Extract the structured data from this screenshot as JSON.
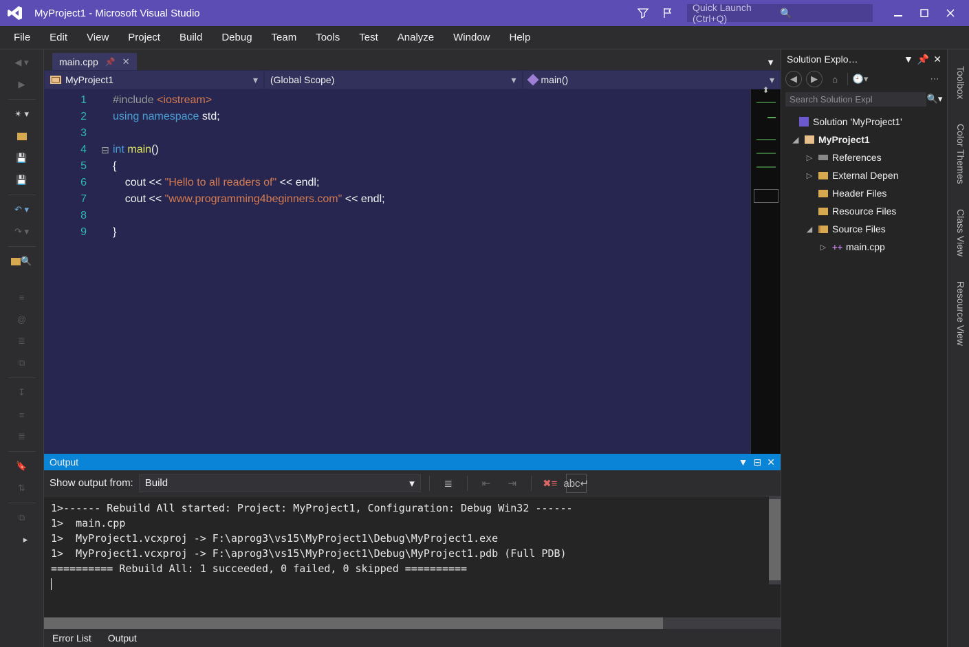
{
  "title": "MyProject1 - Microsoft Visual Studio",
  "quick_launch_placeholder": "Quick Launch (Ctrl+Q)",
  "menu": [
    "File",
    "Edit",
    "View",
    "Project",
    "Build",
    "Debug",
    "Team",
    "Tools",
    "Test",
    "Analyze",
    "Window",
    "Help"
  ],
  "tab": {
    "name": "main.cpp"
  },
  "nav": {
    "project": "MyProject1",
    "scope": "(Global Scope)",
    "member": "main()"
  },
  "code": {
    "lines": [
      {
        "n": "1",
        "html": "<span class='k-prep'>#include</span> <span class='k-include'>&lt;iostream&gt;</span>"
      },
      {
        "n": "2",
        "html": "<span class='k-blue'>using</span> <span class='k-blue'>namespace</span> std;"
      },
      {
        "n": "3",
        "html": ""
      },
      {
        "n": "4",
        "html": "<span class='k-blue'>int</span> <span class='k-yellow'>main</span>()"
      },
      {
        "n": "5",
        "html": "{"
      },
      {
        "n": "6",
        "html": "    cout &lt;&lt; <span class='k-str'>\"Hello to all readers of\"</span> &lt;&lt; endl;"
      },
      {
        "n": "7",
        "html": "    cout &lt;&lt; <span class='k-str'>\"www.programming4beginners.com\"</span> &lt;&lt; endl;"
      },
      {
        "n": "8",
        "html": ""
      },
      {
        "n": "9",
        "html": "}"
      }
    ]
  },
  "output_panel": {
    "title": "Output",
    "show_from_label": "Show output from:",
    "show_from_value": "Build",
    "lines": [
      "1>------ Rebuild All started: Project: MyProject1, Configuration: Debug Win32 ------",
      "1>  main.cpp",
      "1>  MyProject1.vcxproj -> F:\\aprog3\\vs15\\MyProject1\\Debug\\MyProject1.exe",
      "1>  MyProject1.vcxproj -> F:\\aprog3\\vs15\\MyProject1\\Debug\\MyProject1.pdb (Full PDB)",
      "========== Rebuild All: 1 succeeded, 0 failed, 0 skipped =========="
    ]
  },
  "bottom_tabs": [
    "Error List",
    "Output"
  ],
  "solution_explorer": {
    "title": "Solution Explo…",
    "search_placeholder": "Search Solution Expl",
    "solution": "Solution 'MyProject1'",
    "project": "MyProject1",
    "nodes": {
      "references": "References",
      "external": "External Depen",
      "header": "Header Files",
      "resource": "Resource Files",
      "source": "Source Files",
      "maincpp": "main.cpp"
    }
  },
  "right_tabs": [
    "Toolbox",
    "Color Themes",
    "Class View",
    "Resource View"
  ]
}
